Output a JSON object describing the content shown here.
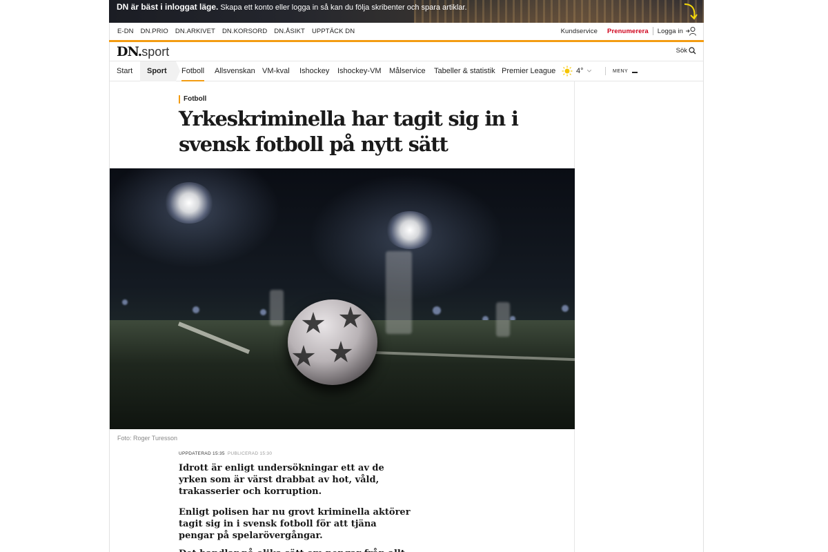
{
  "promo": {
    "headline": "DN är bäst i inloggat läge.",
    "text": "Skapa ett konto eller logga in så kan du följa skribenter och spara artiklar."
  },
  "toplinks": {
    "items": [
      "E-DN",
      "DN.PRIO",
      "DN.ARKIVET",
      "DN.KORSORD",
      "DN.ÅSIKT",
      "UPPTÄCK DN"
    ],
    "kundservice": "Kundservice",
    "prenumerera": "Prenumerera",
    "login": "Logga in"
  },
  "brand": {
    "logo_main": "DN.",
    "logo_section": "sport",
    "search_label": "Sök"
  },
  "nav": {
    "start": "Start",
    "sport": "Sport",
    "items": [
      "Fotboll",
      "Allsvenskan",
      "VM-kval",
      "Ishockey",
      "Ishockey-VM",
      "Målservice",
      "Tabeller & statistik",
      "Premier League"
    ],
    "active_index": 0,
    "temperature": "4°",
    "menu_label": "MENY"
  },
  "article": {
    "kicker": "Fotboll",
    "headline": "Yrkeskriminella har tagit sig in i svensk fotboll på nytt sätt",
    "caption": "Foto: Roger Turesson",
    "updated": "UPPDATERAD 15:35",
    "published": "PUBLICERAD 15:30",
    "lead1": "Idrott är enligt undersökningar ett av de yrken som är värst drabbat av hot, våld, trakasserier och korruption.",
    "lead2": "Enligt polisen har nu grovt kriminella aktörer tagit sig in i svensk fotboll för att tjäna pengar på spelarövergångar.",
    "lead3": "Det handlar på olika sätt om pengar från allt från"
  },
  "colors": {
    "accent": "#f39c12",
    "prenumerera": "#d0021b"
  }
}
